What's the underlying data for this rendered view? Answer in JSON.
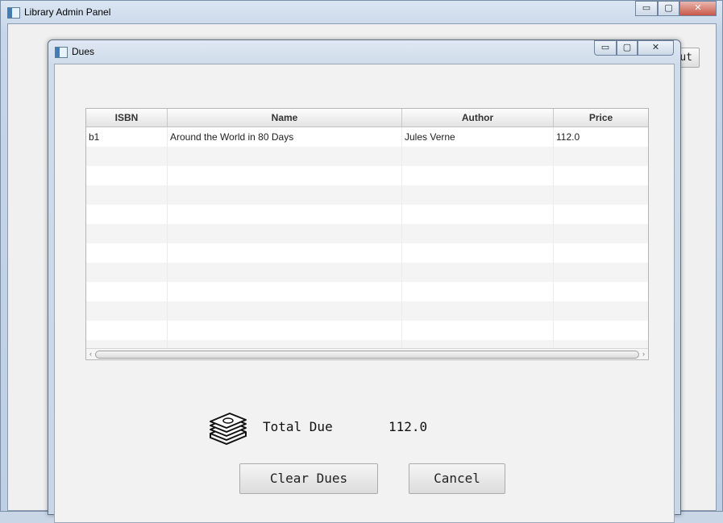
{
  "main_window": {
    "title": "Library Admin Panel",
    "controls": {
      "minimize": "▭",
      "maximize": "▢",
      "close": "✕"
    },
    "logout_label": "Logout"
  },
  "dues_window": {
    "title": "Dues",
    "controls": {
      "minimize": "▭",
      "maximize": "▢",
      "close": "✕"
    },
    "table": {
      "columns": [
        "ISBN",
        "Name",
        "Author",
        "Price"
      ],
      "rows": [
        [
          "b1",
          "Around the World in 80 Days",
          "Jules Verne",
          "112.0"
        ]
      ]
    },
    "total_due_label": "Total Due",
    "total_due_value": "112.0",
    "money_icon": "cash-stack-icon",
    "clear_dues_label": "Clear Dues",
    "cancel_label": "Cancel"
  }
}
